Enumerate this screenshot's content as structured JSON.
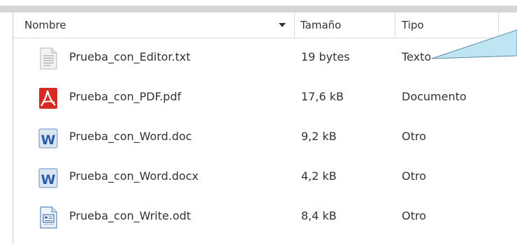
{
  "header": {
    "name": "Nombre",
    "size": "Tamaño",
    "type": "Tipo"
  },
  "files": [
    {
      "name": "Prueba_con_Editor.txt",
      "size": "19 bytes",
      "type": "Texto",
      "icon": "text-file-icon"
    },
    {
      "name": "Prueba_con_PDF.pdf",
      "size": "17,6 kB",
      "type": "Documento",
      "icon": "pdf-file-icon"
    },
    {
      "name": "Prueba_con_Word.doc",
      "size": "9,2 kB",
      "type": "Otro",
      "icon": "word-file-icon"
    },
    {
      "name": "Prueba_con_Word.docx",
      "size": "4,2 kB",
      "type": "Otro",
      "icon": "word-file-icon"
    },
    {
      "name": "Prueba_con_Write.odt",
      "size": "8,4 kB",
      "type": "Otro",
      "icon": "writer-file-icon"
    }
  ],
  "colors": {
    "callout_fill": "#bfe4f2",
    "callout_stroke": "#5a8ea6",
    "pdf_red": "#d62b25",
    "word_blue": "#2a5caa"
  }
}
